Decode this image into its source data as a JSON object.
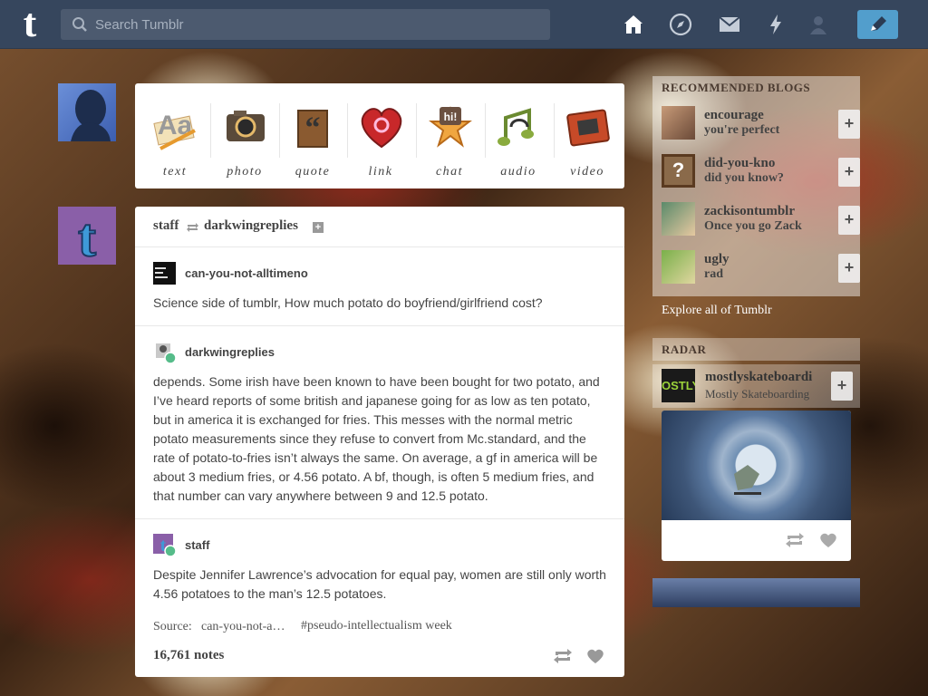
{
  "topbar": {
    "logo": "t",
    "search_placeholder": "Search Tumblr",
    "nav_icons": [
      "home-icon",
      "explore-icon",
      "inbox-icon",
      "activity-icon",
      "account-icon"
    ],
    "compose_icon": "pencil-icon"
  },
  "post_types": [
    {
      "label": "text",
      "icon": "text-icon"
    },
    {
      "label": "photo",
      "icon": "camera-icon"
    },
    {
      "label": "quote",
      "icon": "quote-icon"
    },
    {
      "label": "link",
      "icon": "link-icon"
    },
    {
      "label": "chat",
      "icon": "chat-icon"
    },
    {
      "label": "audio",
      "icon": "headphones-icon"
    },
    {
      "label": "video",
      "icon": "film-icon"
    }
  ],
  "post": {
    "header": {
      "author": "staff",
      "reblogged_from": "darkwingreplies"
    },
    "entries": [
      {
        "blog": "can-you-not-alltimeno",
        "text": "Science side of tumblr, How much potato do boyfriend/girlfriend cost?"
      },
      {
        "blog": "darkwingreplies",
        "text": "depends. Some irish have been known to have been bought for two potato, and I’ve heard reports of some british and japanese going for as low as ten potato, but in america it is exchanged for fries. This messes with the normal metric potato measurements since they refuse to convert from Mc.standard, and the rate of potato-to-fries isn’t always the same. On average, a gf in america will be about 3 medium fries, or 4.56 potato. A bf, though, is often 5 medium fries, and that number can vary anywhere between 9 and 12.5 potato."
      },
      {
        "blog": "staff",
        "text": "Despite Jennifer Lawrence’s advocation for equal pay, women are still only worth 4.56 potatoes to the man’s 12.5 potatoes."
      }
    ],
    "source_label": "Source:",
    "source_value": "can-you-not-a…",
    "tag": "#pseudo-intellectualism week",
    "notes": "16,761 notes"
  },
  "sidebar": {
    "recommended_title": "RECOMMENDED BLOGS",
    "recommended": [
      {
        "name": "encourage",
        "sub": "you're perfect"
      },
      {
        "name": "did-you-kno",
        "sub": "did you know?"
      },
      {
        "name": "zackisontumblr",
        "sub": "Once you go Zack"
      },
      {
        "name": "ugly",
        "sub": "rad"
      }
    ],
    "follow_label": "+",
    "explore": "Explore all of Tumblr",
    "radar_title": "RADAR",
    "radar_blog": {
      "name": "mostlyskateboardi",
      "sub": "Mostly Skateboarding"
    }
  }
}
